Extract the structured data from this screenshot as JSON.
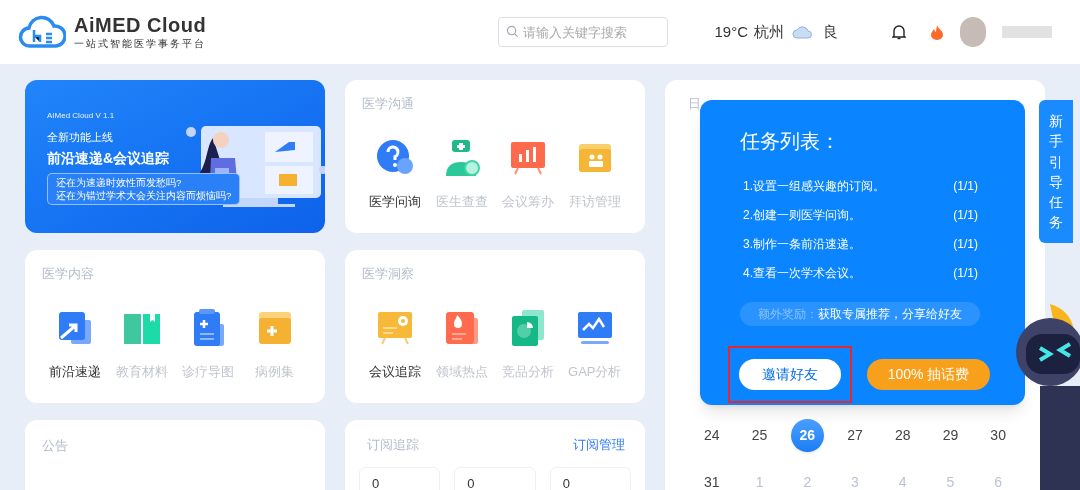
{
  "header": {
    "logo": {
      "name": "AiMED Cloud",
      "tagline": "一站式智能医学事务平台"
    },
    "search": {
      "placeholder": "请输入关键字搜索"
    },
    "weather": {
      "temperature": "19°C",
      "city": "杭州",
      "air_quality": "良"
    }
  },
  "banner": {
    "version": "AIMed Cloud V 1.1",
    "kicker": "全新功能上线",
    "headline": "前沿速递&会议追踪",
    "questions": [
      "还在为速递时效性而发愁吗?",
      "还在为错过学术大会关注内容而烦恼吗?"
    ]
  },
  "medical_communication": {
    "title": "医学沟通",
    "items": [
      {
        "label": "医学问询",
        "disabled": false
      },
      {
        "label": "医生查查",
        "disabled": true
      },
      {
        "label": "会议筹办",
        "disabled": true
      },
      {
        "label": "拜访管理",
        "disabled": true
      }
    ]
  },
  "medical_content": {
    "title": "医学内容",
    "items": [
      {
        "label": "前沿速递",
        "disabled": false
      },
      {
        "label": "教育材料",
        "disabled": true
      },
      {
        "label": "诊疗导图",
        "disabled": true
      },
      {
        "label": "病例集",
        "disabled": true
      }
    ]
  },
  "medical_insight": {
    "title": "医学洞察",
    "items": [
      {
        "label": "会议追踪",
        "disabled": false
      },
      {
        "label": "领域热点",
        "disabled": true
      },
      {
        "label": "竞品分析",
        "disabled": true
      },
      {
        "label": "GAP分析",
        "disabled": true
      }
    ]
  },
  "notice": {
    "title": "公告"
  },
  "subscriptions": {
    "title": "订阅追踪",
    "manage_link": "订阅管理",
    "counts": [
      "0",
      "0",
      "0"
    ]
  },
  "calendar": {
    "title": "日",
    "weeks": [
      [
        {
          "day": "24",
          "other_month": false,
          "selected": false
        },
        {
          "day": "25",
          "other_month": false,
          "selected": false
        },
        {
          "day": "26",
          "other_month": false,
          "selected": true
        },
        {
          "day": "27",
          "other_month": false,
          "selected": false
        },
        {
          "day": "28",
          "other_month": false,
          "selected": false
        },
        {
          "day": "29",
          "other_month": false,
          "selected": false
        },
        {
          "day": "30",
          "other_month": false,
          "selected": false
        }
      ],
      [
        {
          "day": "31",
          "other_month": false,
          "selected": false
        },
        {
          "day": "1",
          "other_month": true,
          "selected": false
        },
        {
          "day": "2",
          "other_month": true,
          "selected": false
        },
        {
          "day": "3",
          "other_month": true,
          "selected": false
        },
        {
          "day": "4",
          "other_month": true,
          "selected": false
        },
        {
          "day": "5",
          "other_month": true,
          "selected": false
        },
        {
          "day": "6",
          "other_month": true,
          "selected": false
        }
      ]
    ]
  },
  "task_popup": {
    "title": "任务列表：",
    "tasks": [
      {
        "label": "1.设置一组感兴趣的订阅。",
        "progress": "(1/1)",
        "completed": true
      },
      {
        "label": "2.创建一则医学问询。",
        "progress": "(1/1)",
        "completed": true
      },
      {
        "label": "3.制作一条前沿速递。",
        "progress": "(1/1)",
        "completed": true
      },
      {
        "label": "4.查看一次学术会议。",
        "progress": "(1/1)",
        "completed": true
      }
    ],
    "bonus": {
      "label": "额外奖励：",
      "text": "获取专属推荐，分享给好友"
    },
    "buttons": [
      {
        "label": "邀请好友",
        "kind": "secondary",
        "highlighted": true
      },
      {
        "label": "100% 抽话费",
        "kind": "primary",
        "highlighted": false
      }
    ]
  },
  "guide_tab": {
    "label": "新手引导任务"
  }
}
